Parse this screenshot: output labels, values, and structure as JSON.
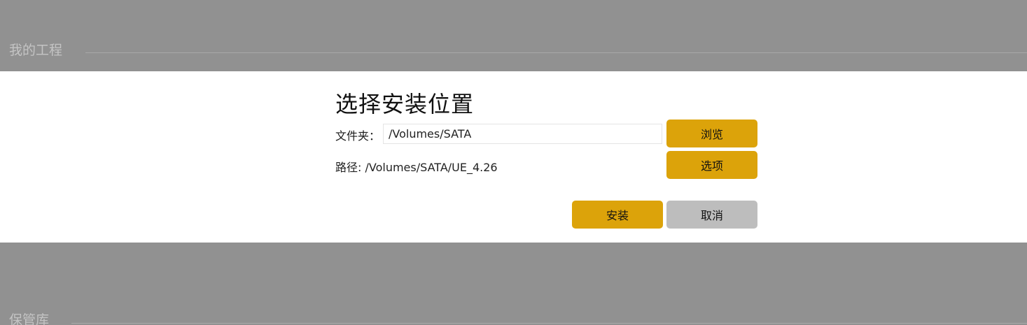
{
  "background": {
    "my_projects_title": "我的工程",
    "vault_title": "保管库"
  },
  "dialog": {
    "title": "选择安装位置",
    "folder_label": "文件夹：",
    "folder_value": "/Volumes/SATA",
    "path_label": "路径:",
    "path_value": "/Volumes/SATA/UE_4.26",
    "browse_label": "浏览",
    "options_label": "选项",
    "install_label": "安装",
    "cancel_label": "取消"
  },
  "colors": {
    "accent": "#dca30a",
    "muted_button": "#bdbdbd",
    "backdrop": "#919191"
  }
}
